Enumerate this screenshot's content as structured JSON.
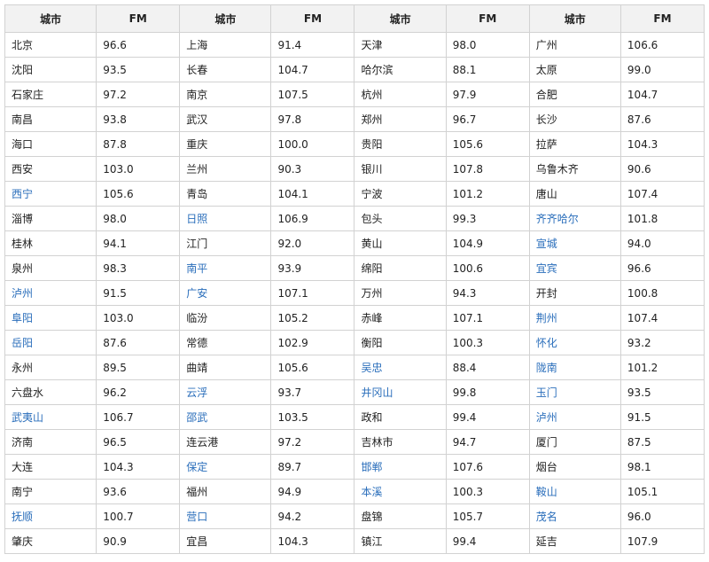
{
  "table": {
    "headers": [
      "城市",
      "FM",
      "城市",
      "FM",
      "城市",
      "FM",
      "城市",
      "FM"
    ],
    "link_color": "#2a6ebb",
    "rows": [
      [
        {
          "city": "北京",
          "fm": "96.6"
        },
        {
          "city": "上海",
          "fm": "91.4"
        },
        {
          "city": "天津",
          "fm": "98.0"
        },
        {
          "city": "广州",
          "fm": "106.6"
        }
      ],
      [
        {
          "city": "沈阳",
          "fm": "93.5"
        },
        {
          "city": "长春",
          "fm": "104.7"
        },
        {
          "city": "哈尔滨",
          "fm": "88.1"
        },
        {
          "city": "太原",
          "fm": "99.0"
        }
      ],
      [
        {
          "city": "石家庄",
          "fm": "97.2"
        },
        {
          "city": "南京",
          "fm": "107.5"
        },
        {
          "city": "杭州",
          "fm": "97.9"
        },
        {
          "city": "合肥",
          "fm": "104.7"
        }
      ],
      [
        {
          "city": "南昌",
          "fm": "93.8"
        },
        {
          "city": "武汉",
          "fm": "97.8"
        },
        {
          "city": "郑州",
          "fm": "96.7"
        },
        {
          "city": "长沙",
          "fm": "87.6"
        }
      ],
      [
        {
          "city": "海口",
          "fm": "87.8"
        },
        {
          "city": "重庆",
          "fm": "100.0"
        },
        {
          "city": "贵阳",
          "fm": "105.6"
        },
        {
          "city": "拉萨",
          "fm": "104.3"
        }
      ],
      [
        {
          "city": "西安",
          "fm": "103.0"
        },
        {
          "city": "兰州",
          "fm": "90.3"
        },
        {
          "city": "银川",
          "fm": "107.8"
        },
        {
          "city": "乌鲁木齐",
          "fm": "90.6"
        }
      ],
      [
        {
          "city": "西宁",
          "fm": "105.6",
          "link": true
        },
        {
          "city": "青岛",
          "fm": "104.1"
        },
        {
          "city": "宁波",
          "fm": "101.2"
        },
        {
          "city": "唐山",
          "fm": "107.4"
        }
      ],
      [
        {
          "city": "淄博",
          "fm": "98.0"
        },
        {
          "city": "日照",
          "fm": "106.9",
          "link": true
        },
        {
          "city": "包头",
          "fm": "99.3"
        },
        {
          "city": "齐齐哈尔",
          "fm": "101.8",
          "link": true
        }
      ],
      [
        {
          "city": "桂林",
          "fm": "94.1"
        },
        {
          "city": "江门",
          "fm": "92.0"
        },
        {
          "city": "黄山",
          "fm": "104.9"
        },
        {
          "city": "宣城",
          "fm": "94.0",
          "link": true
        }
      ],
      [
        {
          "city": "泉州",
          "fm": "98.3"
        },
        {
          "city": "南平",
          "fm": "93.9",
          "link": true
        },
        {
          "city": "绵阳",
          "fm": "100.6"
        },
        {
          "city": "宜宾",
          "fm": "96.6",
          "link": true
        }
      ],
      [
        {
          "city": "泸州",
          "fm": "91.5",
          "link": true
        },
        {
          "city": "广安",
          "fm": "107.1",
          "link": true
        },
        {
          "city": "万州",
          "fm": "94.3"
        },
        {
          "city": "开封",
          "fm": "100.8"
        }
      ],
      [
        {
          "city": "阜阳",
          "fm": "103.0",
          "link": true
        },
        {
          "city": "临汾",
          "fm": "105.2"
        },
        {
          "city": "赤峰",
          "fm": "107.1"
        },
        {
          "city": "荆州",
          "fm": "107.4",
          "link": true
        }
      ],
      [
        {
          "city": "岳阳",
          "fm": "87.6",
          "link": true
        },
        {
          "city": "常德",
          "fm": "102.9"
        },
        {
          "city": "衡阳",
          "fm": "100.3"
        },
        {
          "city": "怀化",
          "fm": "93.2",
          "link": true
        }
      ],
      [
        {
          "city": "永州",
          "fm": "89.5"
        },
        {
          "city": "曲靖",
          "fm": "105.6"
        },
        {
          "city": "吴忠",
          "fm": "88.4",
          "link": true
        },
        {
          "city": "陇南",
          "fm": "101.2",
          "link": true
        }
      ],
      [
        {
          "city": "六盘水",
          "fm": "96.2"
        },
        {
          "city": "云浮",
          "fm": "93.7",
          "link": true
        },
        {
          "city": "井冈山",
          "fm": "99.8",
          "link": true
        },
        {
          "city": "玉门",
          "fm": "93.5",
          "link": true
        }
      ],
      [
        {
          "city": "武夷山",
          "fm": "106.7",
          "link": true
        },
        {
          "city": "邵武",
          "fm": "103.5",
          "link": true
        },
        {
          "city": "政和",
          "fm": "99.4"
        },
        {
          "city": "泸州",
          "fm": "91.5",
          "link": true
        }
      ],
      [
        {
          "city": "济南",
          "fm": "96.5"
        },
        {
          "city": "连云港",
          "fm": "97.2"
        },
        {
          "city": "吉林市",
          "fm": "94.7"
        },
        {
          "city": "厦门",
          "fm": "87.5"
        }
      ],
      [
        {
          "city": "大连",
          "fm": "104.3"
        },
        {
          "city": "保定",
          "fm": "89.7",
          "link": true
        },
        {
          "city": "邯郸",
          "fm": "107.6",
          "link": true
        },
        {
          "city": "烟台",
          "fm": "98.1"
        }
      ],
      [
        {
          "city": "南宁",
          "fm": "93.6"
        },
        {
          "city": "福州",
          "fm": "94.9"
        },
        {
          "city": "本溪",
          "fm": "100.3",
          "link": true
        },
        {
          "city": "鞍山",
          "fm": "105.1",
          "link": true
        }
      ],
      [
        {
          "city": "抚顺",
          "fm": "100.7",
          "link": true
        },
        {
          "city": "营口",
          "fm": "94.2",
          "link": true
        },
        {
          "city": "盘锦",
          "fm": "105.7"
        },
        {
          "city": "茂名",
          "fm": "96.0",
          "link": true
        }
      ],
      [
        {
          "city": "肇庆",
          "fm": "90.9"
        },
        {
          "city": "宜昌",
          "fm": "104.3"
        },
        {
          "city": "镇江",
          "fm": "99.4"
        },
        {
          "city": "延吉",
          "fm": "107.9"
        }
      ]
    ]
  }
}
